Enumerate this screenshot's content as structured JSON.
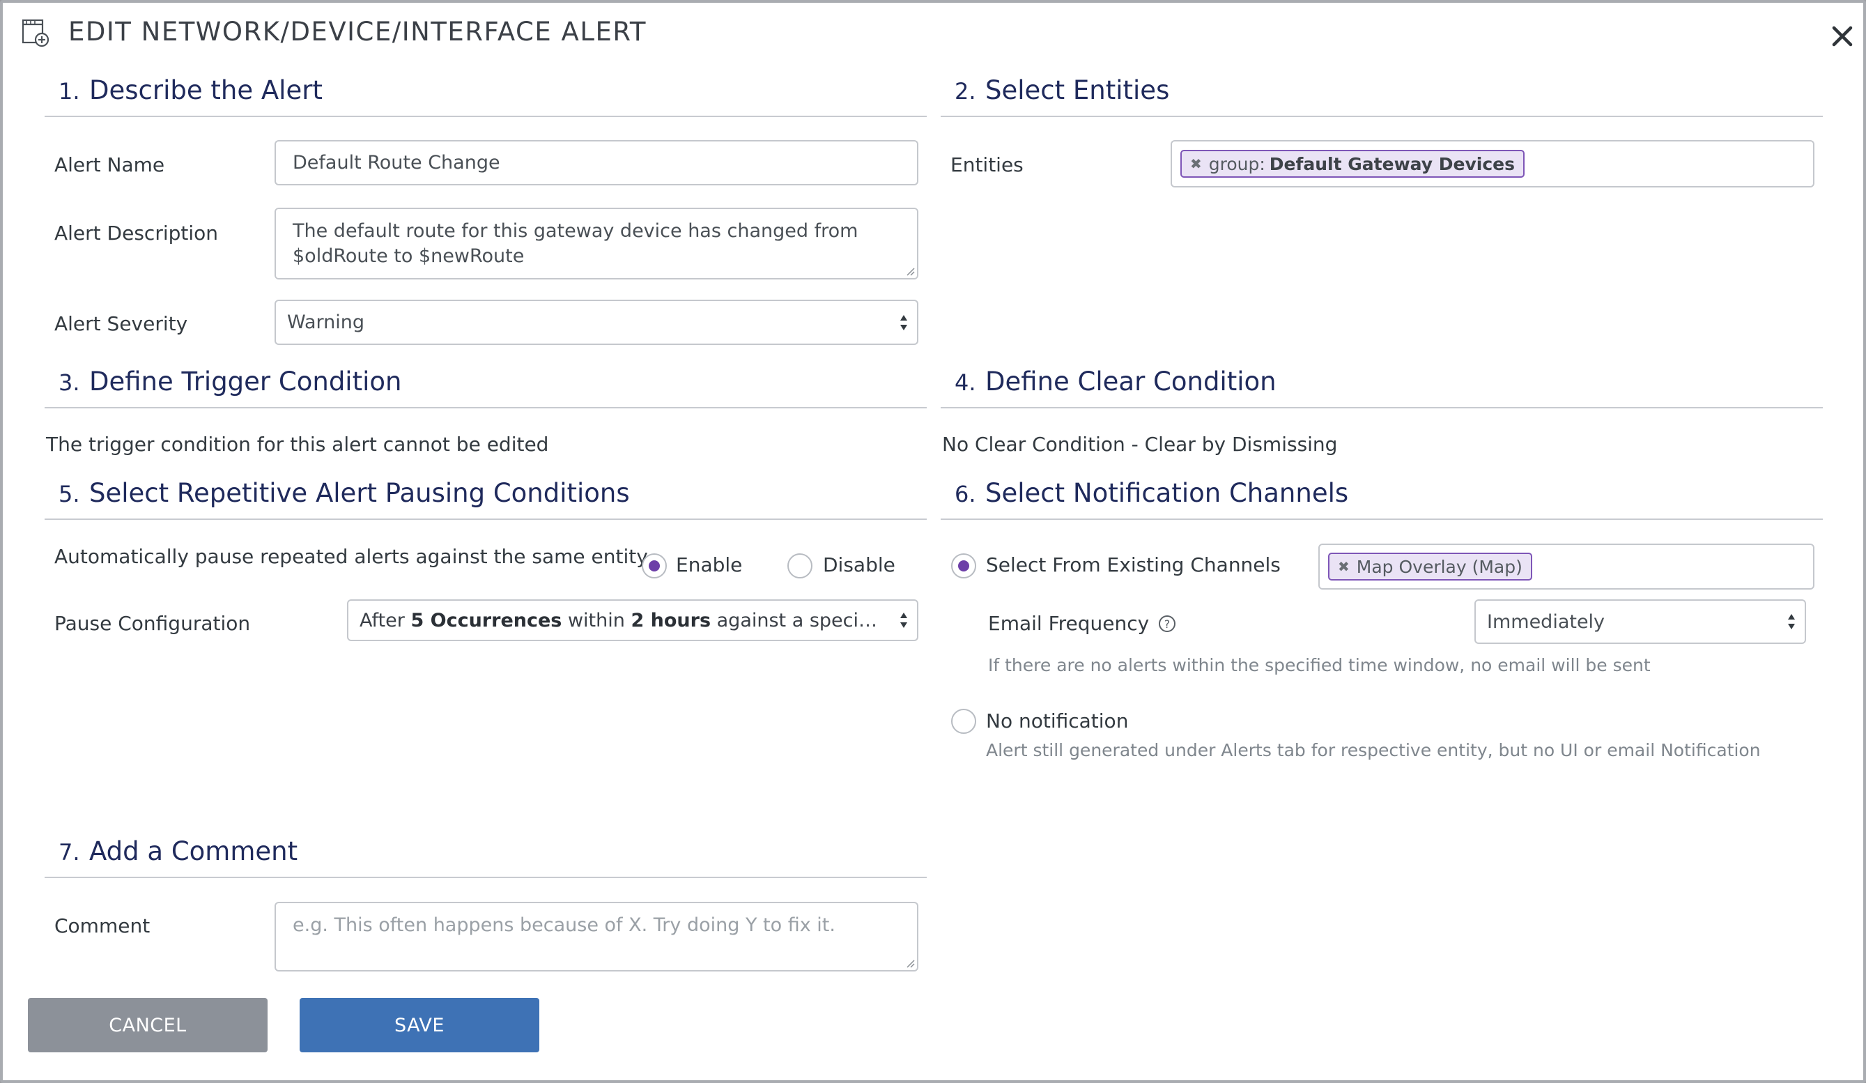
{
  "dialog": {
    "title": "EDIT NETWORK/DEVICE/INTERFACE ALERT"
  },
  "sections": {
    "s1": {
      "num": "1.",
      "title": "Describe the Alert"
    },
    "s2": {
      "num": "2.",
      "title": "Select Entities"
    },
    "s3": {
      "num": "3.",
      "title": "Define Trigger Condition"
    },
    "s4": {
      "num": "4.",
      "title": "Define Clear Condition"
    },
    "s5": {
      "num": "5.",
      "title": "Select Repetitive Alert Pausing Conditions"
    },
    "s6": {
      "num": "6.",
      "title": "Select Notification Channels"
    },
    "s7": {
      "num": "7.",
      "title": "Add a Comment"
    }
  },
  "describe": {
    "name_label": "Alert Name",
    "name_value": "Default Route Change",
    "description_label": "Alert Description",
    "description_value": "The default route for this gateway device has changed from $oldRoute to $newRoute",
    "severity_label": "Alert Severity",
    "severity_value": "Warning"
  },
  "entities": {
    "label": "Entities",
    "tag_prefix": "group:",
    "tag_value": "Default Gateway Devices"
  },
  "trigger": {
    "message": "The trigger condition for this alert cannot be edited"
  },
  "clear": {
    "message": "No Clear Condition - Clear by Dismissing"
  },
  "pausing": {
    "auto_label": "Automatically pause repeated alerts against the same entity",
    "enable_label": "Enable",
    "disable_label": "Disable",
    "selected": "enable",
    "config_label": "Pause Configuration",
    "config_parts": {
      "p1": "After",
      "occurrences": "5 Occurrences",
      "p2": "within",
      "window": "2 hours",
      "p3": "against a specific device..."
    }
  },
  "notification": {
    "existing_label": "Select From Existing Channels",
    "channel_tag": "Map Overlay (Map)",
    "email_freq_label": "Email Frequency",
    "email_freq_value": "Immediately",
    "email_hint": "If there are no alerts within the specified time window, no email will be sent",
    "none_label": "No notification",
    "none_hint": "Alert still generated under Alerts tab for respective entity, but no UI or email Notification",
    "selected": "existing"
  },
  "comment": {
    "label": "Comment",
    "placeholder": "e.g. This often happens because of X. Try doing Y to fix it."
  },
  "actions": {
    "cancel_label": "CANCEL",
    "save_label": "SAVE"
  },
  "colors": {
    "heading": "#1f2a5c",
    "accent": "#6d3fa8",
    "save": "#3e72b5",
    "cancel": "#8c9199"
  },
  "icons": {
    "header": "add-alert-icon",
    "close": "close-icon",
    "help": "help-circle-icon"
  }
}
